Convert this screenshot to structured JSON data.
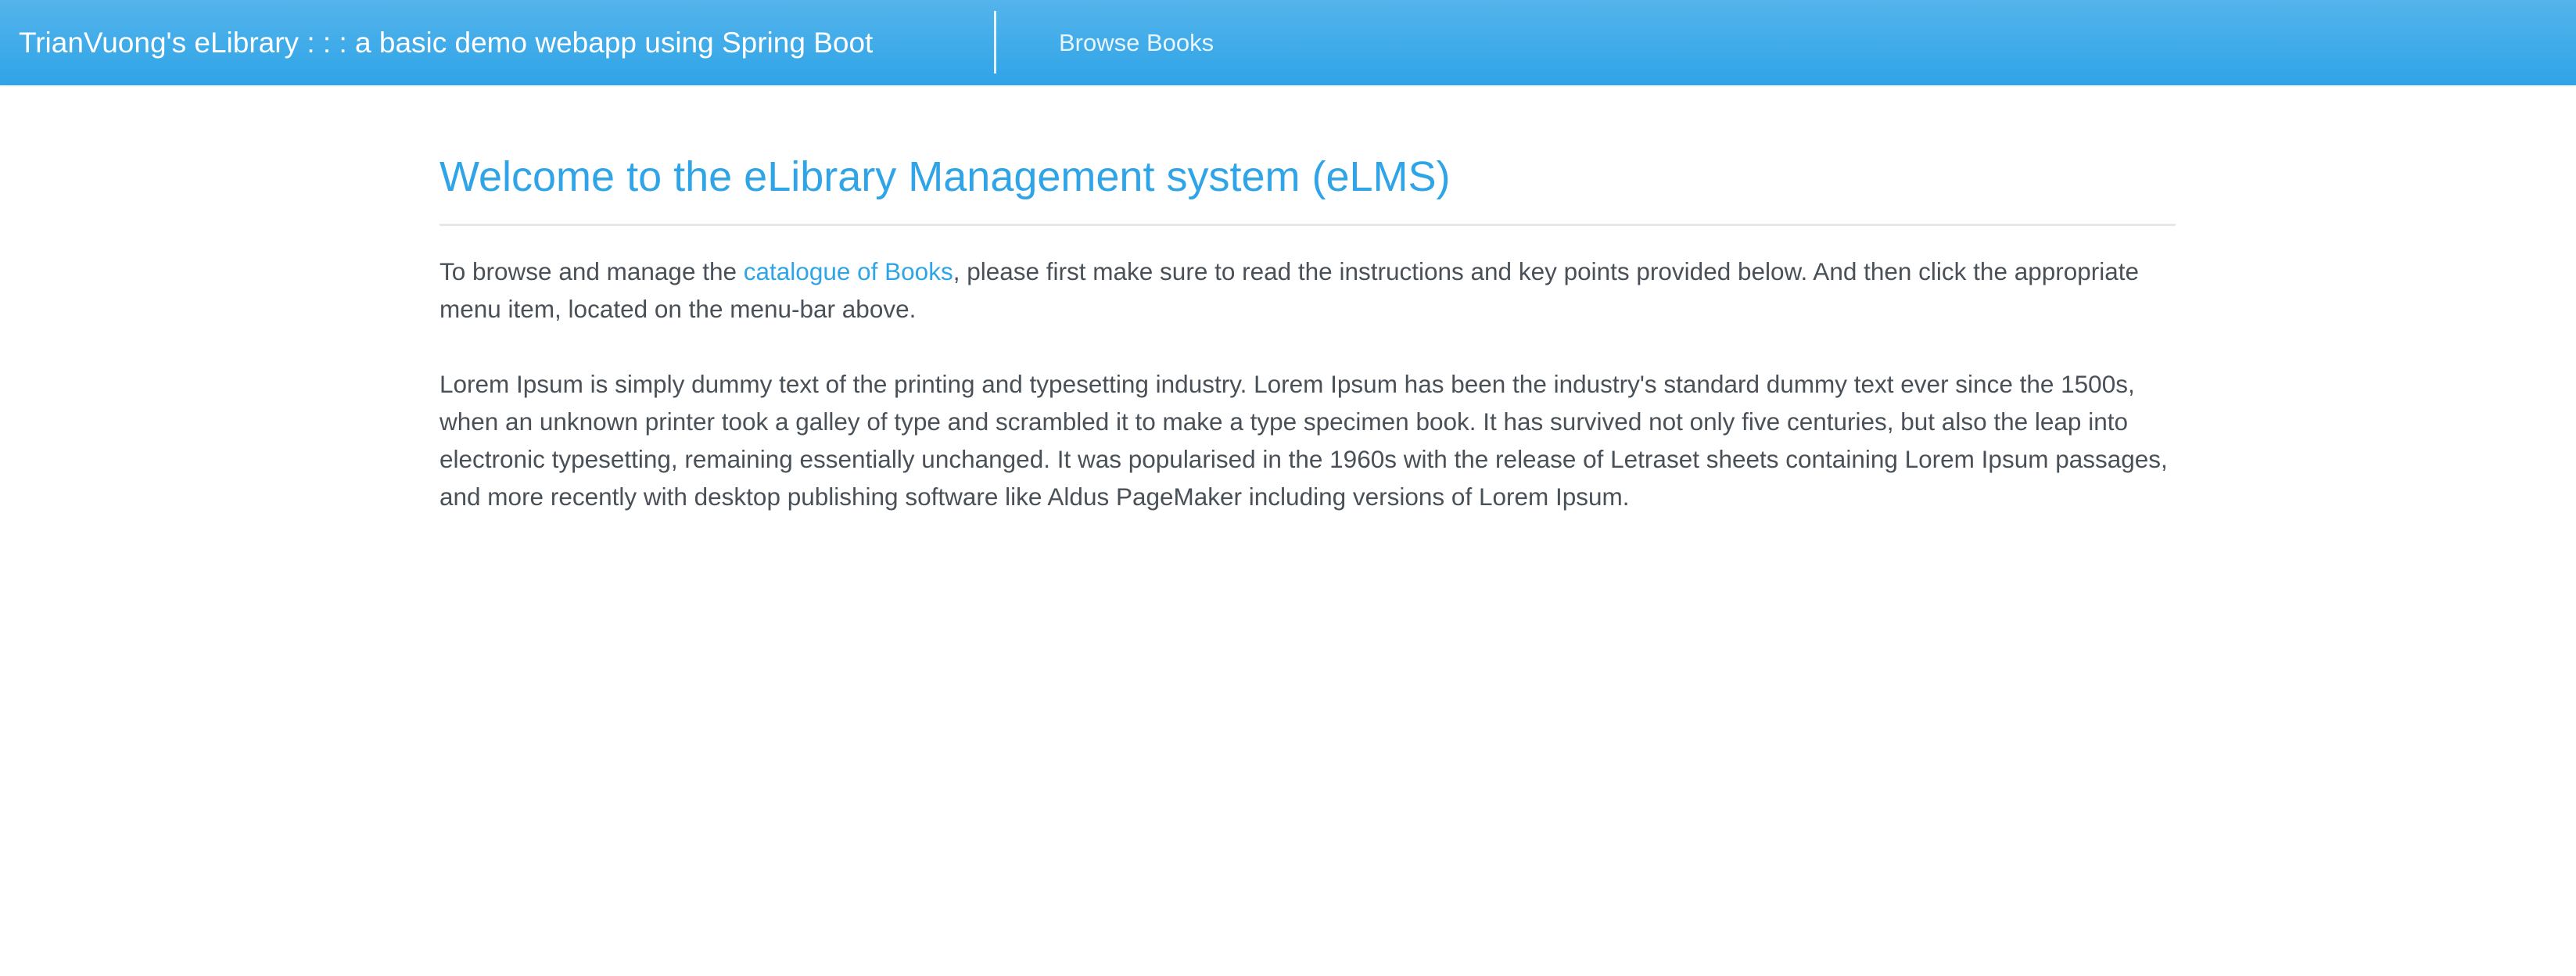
{
  "navbar": {
    "brand": "TrianVuong's eLibrary : : : a basic demo webapp using Spring Boot",
    "links": [
      {
        "label": "Browse Books"
      }
    ]
  },
  "main": {
    "title": "Welcome to the eLibrary Management system (eLMS)",
    "intro": {
      "before_link": "To browse and manage the ",
      "link_text": "catalogue of Books",
      "after_link": ", please first make sure to read the instructions and key points provided below. And then click the appropriate menu item, located on the menu-bar above."
    },
    "body_paragraph": "Lorem Ipsum is simply dummy text of the printing and typesetting industry. Lorem Ipsum has been the industry's standard dummy text ever since the 1500s, when an unknown printer took a galley of type and scrambled it to make a type specimen book. It has survived not only five centuries, but also the leap into electronic typesetting, remaining essentially unchanged. It was popularised in the 1960s with the release of Letraset sheets containing Lorem Ipsum passages, and more recently with desktop publishing software like Aldus PageMaker including versions of Lorem Ipsum."
  },
  "colors": {
    "accent": "#2fa4e7",
    "navbar_top": "#54b4eb",
    "text": "#495057"
  }
}
